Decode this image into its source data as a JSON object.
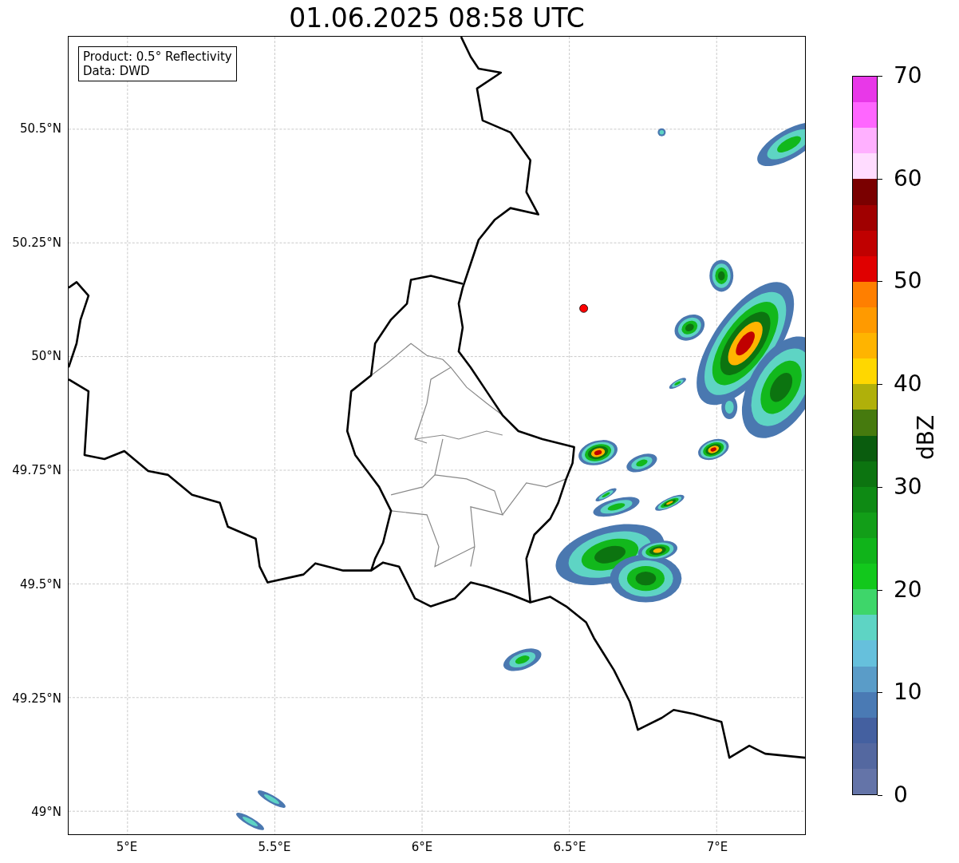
{
  "title": "01.06.2025 08:58 UTC",
  "info_box": [
    "Product: 0.5° Reflectivity",
    "Data: DWD"
  ],
  "x_ticks": [
    "5°E",
    "5.5°E",
    "6°E",
    "6.5°E",
    "7°E"
  ],
  "y_ticks": [
    "50.5°N",
    "50.25°N",
    "50°N",
    "49.75°N",
    "49.5°N",
    "49.25°N",
    "49°N"
  ],
  "colorbar": {
    "label": "dBZ",
    "ticks": [
      "70",
      "60",
      "50",
      "40",
      "30",
      "20",
      "10",
      "0"
    ],
    "bins": [
      {
        "color": "#e838e8"
      },
      {
        "color": "#ff66ff"
      },
      {
        "color": "#ffb0ff"
      },
      {
        "color": "#ffdcff"
      },
      {
        "color": "#7a0000"
      },
      {
        "color": "#a00000"
      },
      {
        "color": "#c00000"
      },
      {
        "color": "#e00000"
      },
      {
        "color": "#ff7f00"
      },
      {
        "color": "#ff9a00"
      },
      {
        "color": "#ffb400"
      },
      {
        "color": "#ffd700"
      },
      {
        "color": "#b0b00a"
      },
      {
        "color": "#467a0e"
      },
      {
        "color": "#0a5c0e"
      },
      {
        "color": "#0c7410"
      },
      {
        "color": "#0e8a14"
      },
      {
        "color": "#129e18"
      },
      {
        "color": "#10b41a"
      },
      {
        "color": "#12c81c"
      },
      {
        "color": "#3ed66a"
      },
      {
        "color": "#5ed4c4"
      },
      {
        "color": "#66c0dc"
      },
      {
        "color": "#5a9cc8"
      },
      {
        "color": "#4a7ab4"
      },
      {
        "color": "#4460a0"
      },
      {
        "color": "#5468a0"
      },
      {
        "color": "#6474a8"
      }
    ]
  }
}
